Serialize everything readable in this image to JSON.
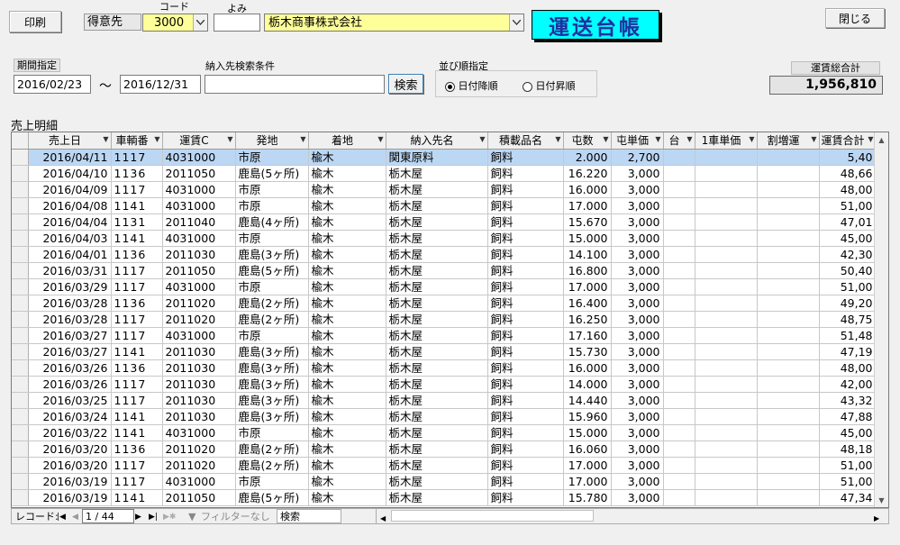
{
  "toolbar": {
    "print_label": "印刷",
    "close_label": "閉じる"
  },
  "header": {
    "customer_label": "得意先",
    "code_label": "コード",
    "yomi_label": "よみ",
    "code_value": "3000",
    "yomi_value": "",
    "company_name": "栃木商事株式会社",
    "form_title": "運送台帳"
  },
  "filters": {
    "period_label": "期間指定",
    "date_from": "2016/02/23",
    "tilde": "〜",
    "date_to": "2016/12/31",
    "dest_search_label": "納入先検索条件",
    "dest_search_value": "",
    "search_button": "検索",
    "sort_label": "並び順指定",
    "sort_desc": "日付降順",
    "sort_asc": "日付昇順",
    "sort_selected": "desc",
    "total_label": "運賃総合計",
    "total_value": "1,956,810"
  },
  "grid": {
    "section_label": "売上明細",
    "columns": [
      "売上日",
      "車輌番",
      "運賃C",
      "発地",
      "着地",
      "納入先名",
      "積載品名",
      "屯数",
      "屯単価",
      "台",
      "1車単価",
      "割増運",
      "運賃合計"
    ],
    "rows": [
      [
        "2016/04/11",
        "1117",
        "4031000",
        "市原",
        "楡木",
        "関東原料",
        "飼料",
        "2.000",
        "2,700",
        "",
        "",
        "",
        "5,40"
      ],
      [
        "2016/04/10",
        "1136",
        "2011050",
        "鹿島(5ヶ所)",
        "楡木",
        "栃木屋",
        "飼料",
        "16.220",
        "3,000",
        "",
        "",
        "",
        "48,66"
      ],
      [
        "2016/04/09",
        "1117",
        "4031000",
        "市原",
        "楡木",
        "栃木屋",
        "飼料",
        "16.000",
        "3,000",
        "",
        "",
        "",
        "48,00"
      ],
      [
        "2016/04/08",
        "1141",
        "4031000",
        "市原",
        "楡木",
        "栃木屋",
        "飼料",
        "17.000",
        "3,000",
        "",
        "",
        "",
        "51,00"
      ],
      [
        "2016/04/04",
        "1131",
        "2011040",
        "鹿島(4ヶ所)",
        "楡木",
        "栃木屋",
        "飼料",
        "15.670",
        "3,000",
        "",
        "",
        "",
        "47,01"
      ],
      [
        "2016/04/03",
        "1141",
        "4031000",
        "市原",
        "楡木",
        "栃木屋",
        "飼料",
        "15.000",
        "3,000",
        "",
        "",
        "",
        "45,00"
      ],
      [
        "2016/04/01",
        "1136",
        "2011030",
        "鹿島(3ヶ所)",
        "楡木",
        "栃木屋",
        "飼料",
        "14.100",
        "3,000",
        "",
        "",
        "",
        "42,30"
      ],
      [
        "2016/03/31",
        "1117",
        "2011050",
        "鹿島(5ヶ所)",
        "楡木",
        "栃木屋",
        "飼料",
        "16.800",
        "3,000",
        "",
        "",
        "",
        "50,40"
      ],
      [
        "2016/03/29",
        "1117",
        "4031000",
        "市原",
        "楡木",
        "栃木屋",
        "飼料",
        "17.000",
        "3,000",
        "",
        "",
        "",
        "51,00"
      ],
      [
        "2016/03/28",
        "1136",
        "2011020",
        "鹿島(2ヶ所)",
        "楡木",
        "栃木屋",
        "飼料",
        "16.400",
        "3,000",
        "",
        "",
        "",
        "49,20"
      ],
      [
        "2016/03/28",
        "1117",
        "2011020",
        "鹿島(2ヶ所)",
        "楡木",
        "栃木屋",
        "飼料",
        "16.250",
        "3,000",
        "",
        "",
        "",
        "48,75"
      ],
      [
        "2016/03/27",
        "1117",
        "4031000",
        "市原",
        "楡木",
        "栃木屋",
        "飼料",
        "17.160",
        "3,000",
        "",
        "",
        "",
        "51,48"
      ],
      [
        "2016/03/27",
        "1141",
        "2011030",
        "鹿島(3ヶ所)",
        "楡木",
        "栃木屋",
        "飼料",
        "15.730",
        "3,000",
        "",
        "",
        "",
        "47,19"
      ],
      [
        "2016/03/26",
        "1136",
        "2011030",
        "鹿島(3ヶ所)",
        "楡木",
        "栃木屋",
        "飼料",
        "16.000",
        "3,000",
        "",
        "",
        "",
        "48,00"
      ],
      [
        "2016/03/26",
        "1117",
        "2011030",
        "鹿島(3ヶ所)",
        "楡木",
        "栃木屋",
        "飼料",
        "14.000",
        "3,000",
        "",
        "",
        "",
        "42,00"
      ],
      [
        "2016/03/25",
        "1117",
        "2011030",
        "鹿島(3ヶ所)",
        "楡木",
        "栃木屋",
        "飼料",
        "14.440",
        "3,000",
        "",
        "",
        "",
        "43,32"
      ],
      [
        "2016/03/24",
        "1141",
        "2011030",
        "鹿島(3ヶ所)",
        "楡木",
        "栃木屋",
        "飼料",
        "15.960",
        "3,000",
        "",
        "",
        "",
        "47,88"
      ],
      [
        "2016/03/22",
        "1141",
        "4031000",
        "市原",
        "楡木",
        "栃木屋",
        "飼料",
        "15.000",
        "3,000",
        "",
        "",
        "",
        "45,00"
      ],
      [
        "2016/03/20",
        "1136",
        "2011020",
        "鹿島(2ヶ所)",
        "楡木",
        "栃木屋",
        "飼料",
        "16.060",
        "3,000",
        "",
        "",
        "",
        "48,18"
      ],
      [
        "2016/03/20",
        "1117",
        "2011020",
        "鹿島(2ヶ所)",
        "楡木",
        "栃木屋",
        "飼料",
        "17.000",
        "3,000",
        "",
        "",
        "",
        "51,00"
      ],
      [
        "2016/03/19",
        "1117",
        "4031000",
        "市原",
        "楡木",
        "栃木屋",
        "飼料",
        "17.000",
        "3,000",
        "",
        "",
        "",
        "51,00"
      ],
      [
        "2016/03/19",
        "1141",
        "2011050",
        "鹿島(5ヶ所)",
        "楡木",
        "栃木屋",
        "飼料",
        "15.780",
        "3,000",
        "",
        "",
        "",
        "47,34"
      ]
    ]
  },
  "navbar": {
    "record_label": "レコード:",
    "record_position": "1 / 44",
    "filter_label": "フィルターなし",
    "search_label": "検索"
  },
  "colors": {
    "combo_bg": "#ffff99",
    "title_bg": "#00ffff",
    "title_fg": "#2030a0",
    "selected_row": "#bcd7f4"
  }
}
